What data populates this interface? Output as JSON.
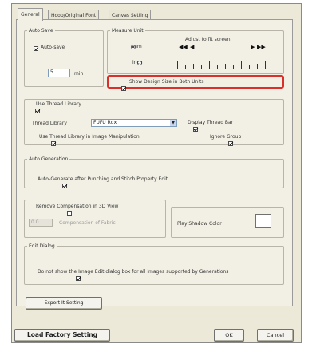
{
  "tabs": [
    "General",
    "Hoop/Original Font",
    "Canvas Setting"
  ],
  "auto_save": {
    "legend": "Auto Save",
    "checkbox_label": "Auto-save",
    "checked": true,
    "interval_value": "5",
    "interval_unit": "min"
  },
  "measure_unit": {
    "legend": "Measure Unit",
    "option_mm": "mm",
    "option_inch": "inch",
    "selected": "mm",
    "adjust_label": "Adjust to fit screen",
    "show_both_label": "Show Design Size in Both Units",
    "show_both_checked": true
  },
  "thread": {
    "use_library_label": "Use Thread Library",
    "use_library_checked": true,
    "library_label": "Thread Library",
    "library_value": "FUFU Rdx",
    "display_bar_label": "Display Thread Bar",
    "display_bar_checked": true,
    "use_manipulation_label": "Use Thread Library in Image Manipulation",
    "use_manipulation_checked": true,
    "ignore_group_label": "Ignore Group",
    "ignore_group_checked": true
  },
  "auto_generation": {
    "legend": "Auto Generation",
    "checkbox_label": "Auto-Generate after Punching and Stitch Property Edit",
    "checked": true
  },
  "remove_comp": {
    "checkbox_label": "Remove Compensation in 3D View",
    "checked": false,
    "value": "0.0",
    "value_label": "Compensation of Fabric",
    "shadow_label": "Play Shadow Color"
  },
  "edit_dialog": {
    "legend": "Edit Dialog",
    "checkbox_label": "Do not show the Image Edit dialog box for all images supported by Generations",
    "checked": true
  },
  "export_button": "Export It Setting",
  "load_factory_button": "Load Factory Setting",
  "ok_button": "OK",
  "cancel_button": "Cancel",
  "colors": {
    "highlight": "#d9302c",
    "dialog_bg": "#ece9d8"
  }
}
